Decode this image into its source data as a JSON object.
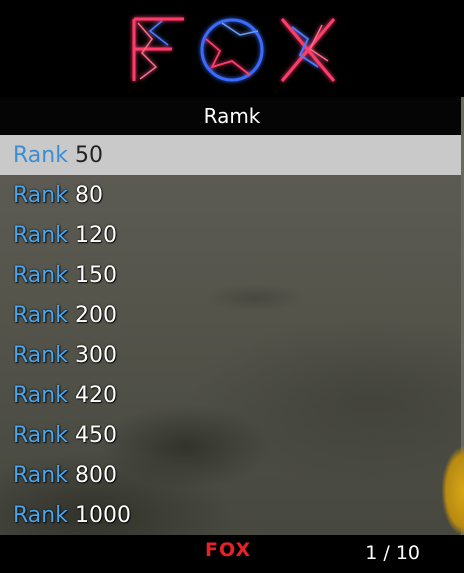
{
  "header": {
    "logo_text": "FOX",
    "subtitle": "Ramk"
  },
  "menu": {
    "items": [
      {
        "prefix": "Rank",
        "value": "50",
        "selected": true
      },
      {
        "prefix": "Rank",
        "value": "80",
        "selected": false
      },
      {
        "prefix": "Rank",
        "value": "120",
        "selected": false
      },
      {
        "prefix": "Rank",
        "value": "150",
        "selected": false
      },
      {
        "prefix": "Rank",
        "value": "200",
        "selected": false
      },
      {
        "prefix": "Rank",
        "value": "300",
        "selected": false
      },
      {
        "prefix": "Rank",
        "value": "420",
        "selected": false
      },
      {
        "prefix": "Rank",
        "value": "450",
        "selected": false
      },
      {
        "prefix": "Rank",
        "value": "800",
        "selected": false
      },
      {
        "prefix": "Rank",
        "value": "1000",
        "selected": false
      }
    ]
  },
  "footer": {
    "logo_text": "FOX",
    "page_indicator": "1 / 10"
  },
  "colors": {
    "prefix_blue": "#4aa6ee",
    "logo_red": "#e8202a",
    "selected_bg": "#c9c9c9"
  }
}
